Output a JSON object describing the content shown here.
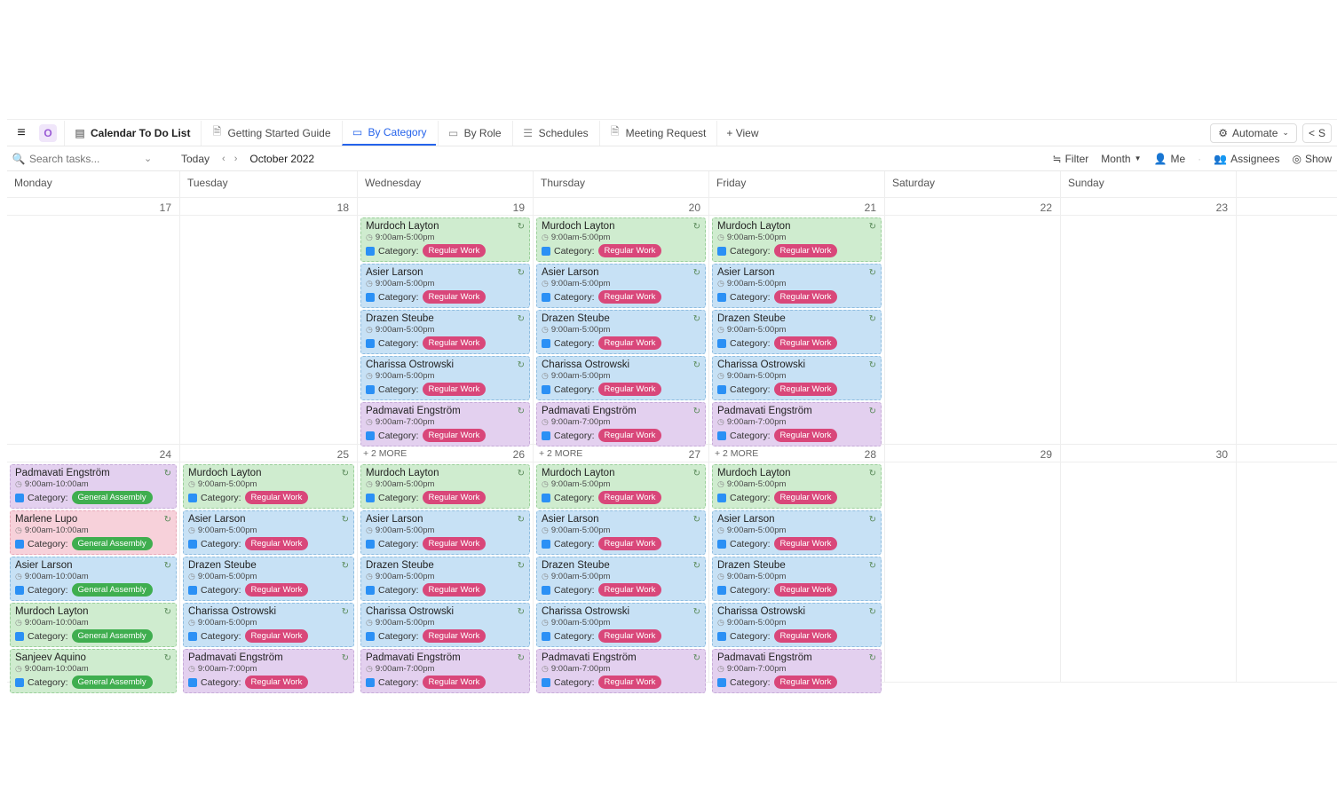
{
  "nav": {
    "logo": "O",
    "title": "Calendar To Do List",
    "tabs": [
      {
        "label": "Getting Started Guide"
      },
      {
        "label": "By Category",
        "active": true
      },
      {
        "label": "By Role"
      },
      {
        "label": "Schedules"
      },
      {
        "label": "Meeting Request"
      }
    ],
    "addView": "+ View",
    "automate": "Automate",
    "share": "S"
  },
  "toolbar": {
    "search_placeholder": "Search tasks...",
    "today": "Today",
    "month_label": "October 2022",
    "filter": "Filter",
    "view": "Month",
    "me": "Me",
    "assignees": "Assignees",
    "show": "Show"
  },
  "daysOfWeek": [
    "Monday",
    "Tuesday",
    "Wednesday",
    "Thursday",
    "Friday",
    "Saturday",
    "Sunday"
  ],
  "row1_dates": [
    "17",
    "18",
    "19",
    "20",
    "21",
    "22",
    "23"
  ],
  "row2_dates": [
    "24",
    "25",
    "26",
    "27",
    "28",
    "29",
    "30"
  ],
  "moreLabel": "+ 2 MORE",
  "categoryLabel": "Category:",
  "badges": {
    "regular": "Regular Work",
    "ga": "General Assembly"
  },
  "events": {
    "wed19": [
      {
        "name": "Murdoch Layton",
        "time": "9:00am-5:00pm",
        "bg": "green",
        "badge": "regular"
      },
      {
        "name": "Asier Larson",
        "time": "9:00am-5:00pm",
        "bg": "blue",
        "badge": "regular"
      },
      {
        "name": "Drazen Steube",
        "time": "9:00am-5:00pm",
        "bg": "blue",
        "badge": "regular"
      },
      {
        "name": "Charissa Ostrowski",
        "time": "9:00am-5:00pm",
        "bg": "blue",
        "badge": "regular"
      },
      {
        "name": "Padmavati Engström",
        "time": "9:00am-7:00pm",
        "bg": "purple",
        "badge": "regular"
      }
    ],
    "thu20": [
      {
        "name": "Murdoch Layton",
        "time": "9:00am-5:00pm",
        "bg": "green",
        "badge": "regular"
      },
      {
        "name": "Asier Larson",
        "time": "9:00am-5:00pm",
        "bg": "blue",
        "badge": "regular"
      },
      {
        "name": "Drazen Steube",
        "time": "9:00am-5:00pm",
        "bg": "blue",
        "badge": "regular"
      },
      {
        "name": "Charissa Ostrowski",
        "time": "9:00am-5:00pm",
        "bg": "blue",
        "badge": "regular"
      },
      {
        "name": "Padmavati Engström",
        "time": "9:00am-7:00pm",
        "bg": "purple",
        "badge": "regular"
      }
    ],
    "fri21": [
      {
        "name": "Murdoch Layton",
        "time": "9:00am-5:00pm",
        "bg": "green",
        "badge": "regular"
      },
      {
        "name": "Asier Larson",
        "time": "9:00am-5:00pm",
        "bg": "blue",
        "badge": "regular"
      },
      {
        "name": "Drazen Steube",
        "time": "9:00am-5:00pm",
        "bg": "blue",
        "badge": "regular"
      },
      {
        "name": "Charissa Ostrowski",
        "time": "9:00am-5:00pm",
        "bg": "blue",
        "badge": "regular"
      },
      {
        "name": "Padmavati Engström",
        "time": "9:00am-7:00pm",
        "bg": "purple",
        "badge": "regular"
      }
    ],
    "mon24": [
      {
        "name": "Padmavati Engström",
        "time": "9:00am-10:00am",
        "bg": "purple",
        "badge": "ga"
      },
      {
        "name": "Marlene Lupo",
        "time": "9:00am-10:00am",
        "bg": "pink",
        "badge": "ga"
      },
      {
        "name": "Asier Larson",
        "time": "9:00am-10:00am",
        "bg": "blue",
        "badge": "ga"
      },
      {
        "name": "Murdoch Layton",
        "time": "9:00am-10:00am",
        "bg": "green",
        "badge": "ga"
      },
      {
        "name": "Sanjeev Aquino",
        "time": "9:00am-10:00am",
        "bg": "green",
        "badge": "ga"
      }
    ],
    "tue25": [
      {
        "name": "Murdoch Layton",
        "time": "9:00am-5:00pm",
        "bg": "green",
        "badge": "regular"
      },
      {
        "name": "Asier Larson",
        "time": "9:00am-5:00pm",
        "bg": "blue",
        "badge": "regular"
      },
      {
        "name": "Drazen Steube",
        "time": "9:00am-5:00pm",
        "bg": "blue",
        "badge": "regular"
      },
      {
        "name": "Charissa Ostrowski",
        "time": "9:00am-5:00pm",
        "bg": "blue",
        "badge": "regular"
      },
      {
        "name": "Padmavati Engström",
        "time": "9:00am-7:00pm",
        "bg": "purple",
        "badge": "regular"
      }
    ],
    "wed26": [
      {
        "name": "Murdoch Layton",
        "time": "9:00am-5:00pm",
        "bg": "green",
        "badge": "regular"
      },
      {
        "name": "Asier Larson",
        "time": "9:00am-5:00pm",
        "bg": "blue",
        "badge": "regular"
      },
      {
        "name": "Drazen Steube",
        "time": "9:00am-5:00pm",
        "bg": "blue",
        "badge": "regular"
      },
      {
        "name": "Charissa Ostrowski",
        "time": "9:00am-5:00pm",
        "bg": "blue",
        "badge": "regular"
      },
      {
        "name": "Padmavati Engström",
        "time": "9:00am-7:00pm",
        "bg": "purple",
        "badge": "regular"
      }
    ],
    "thu27": [
      {
        "name": "Murdoch Layton",
        "time": "9:00am-5:00pm",
        "bg": "green",
        "badge": "regular"
      },
      {
        "name": "Asier Larson",
        "time": "9:00am-5:00pm",
        "bg": "blue",
        "badge": "regular"
      },
      {
        "name": "Drazen Steube",
        "time": "9:00am-5:00pm",
        "bg": "blue",
        "badge": "regular"
      },
      {
        "name": "Charissa Ostrowski",
        "time": "9:00am-5:00pm",
        "bg": "blue",
        "badge": "regular"
      },
      {
        "name": "Padmavati Engström",
        "time": "9:00am-7:00pm",
        "bg": "purple",
        "badge": "regular"
      }
    ],
    "fri28": [
      {
        "name": "Murdoch Layton",
        "time": "9:00am-5:00pm",
        "bg": "green",
        "badge": "regular"
      },
      {
        "name": "Asier Larson",
        "time": "9:00am-5:00pm",
        "bg": "blue",
        "badge": "regular"
      },
      {
        "name": "Drazen Steube",
        "time": "9:00am-5:00pm",
        "bg": "blue",
        "badge": "regular"
      },
      {
        "name": "Charissa Ostrowski",
        "time": "9:00am-5:00pm",
        "bg": "blue",
        "badge": "regular"
      },
      {
        "name": "Padmavati Engström",
        "time": "9:00am-7:00pm",
        "bg": "purple",
        "badge": "regular"
      }
    ]
  }
}
